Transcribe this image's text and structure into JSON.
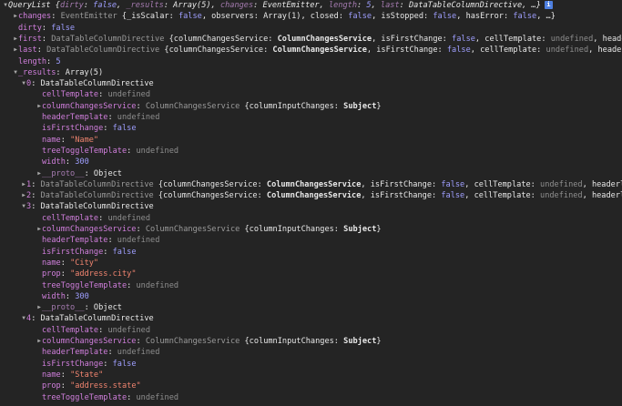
{
  "console": {
    "lines": [
      {
        "indent": 0,
        "toggle": "down",
        "segments": [
          {
            "text": "QueryList ",
            "cls": "t-cls t-it"
          },
          {
            "text": "{",
            "cls": "t-pun t-it"
          },
          {
            "text": "dirty",
            "cls": "t-keydim t-it"
          },
          {
            "text": ": ",
            "cls": "t-pun t-it"
          },
          {
            "text": "false",
            "cls": "t-bool t-it"
          },
          {
            "text": ", ",
            "cls": "t-pun t-it"
          },
          {
            "text": "_results",
            "cls": "t-keydim t-it"
          },
          {
            "text": ": ",
            "cls": "t-pun t-it"
          },
          {
            "text": "Array(5)",
            "cls": "t-cls t-it"
          },
          {
            "text": ", ",
            "cls": "t-pun t-it"
          },
          {
            "text": "changes",
            "cls": "t-keydim t-it"
          },
          {
            "text": ": ",
            "cls": "t-pun t-it"
          },
          {
            "text": "EventEmitter",
            "cls": "t-cls t-it"
          },
          {
            "text": ", ",
            "cls": "t-pun t-it"
          },
          {
            "text": "length",
            "cls": "t-keydim t-it"
          },
          {
            "text": ": ",
            "cls": "t-pun t-it"
          },
          {
            "text": "5",
            "cls": "t-num t-it"
          },
          {
            "text": ", ",
            "cls": "t-pun t-it"
          },
          {
            "text": "last",
            "cls": "t-keydim t-it"
          },
          {
            "text": ": ",
            "cls": "t-pun t-it"
          },
          {
            "text": "DataTableColumnDirective",
            "cls": "t-cls t-it"
          },
          {
            "text": ", …}",
            "cls": "t-pun t-it"
          }
        ],
        "info": "i"
      },
      {
        "indent": 1,
        "toggle": "right",
        "segments": [
          {
            "text": "changes",
            "cls": "t-key"
          },
          {
            "text": ": ",
            "cls": "t-pun"
          },
          {
            "text": "EventEmitter ",
            "cls": "t-clsdim"
          },
          {
            "text": "{_isScalar: ",
            "cls": "t-pun"
          },
          {
            "text": "false",
            "cls": "t-bool"
          },
          {
            "text": ", observers: Array(1), closed: ",
            "cls": "t-pun"
          },
          {
            "text": "false",
            "cls": "t-bool"
          },
          {
            "text": ", isStopped: ",
            "cls": "t-pun"
          },
          {
            "text": "false",
            "cls": "t-bool"
          },
          {
            "text": ", hasError: ",
            "cls": "t-pun"
          },
          {
            "text": "false",
            "cls": "t-bool"
          },
          {
            "text": ", …}",
            "cls": "t-pun"
          }
        ]
      },
      {
        "indent": 1,
        "toggle": "",
        "segments": [
          {
            "text": "dirty",
            "cls": "t-key"
          },
          {
            "text": ": ",
            "cls": "t-pun"
          },
          {
            "text": "false",
            "cls": "t-bool"
          }
        ]
      },
      {
        "indent": 1,
        "toggle": "right",
        "segments": [
          {
            "text": "first",
            "cls": "t-key"
          },
          {
            "text": ": ",
            "cls": "t-pun"
          },
          {
            "text": "DataTableColumnDirective ",
            "cls": "t-clsdim"
          },
          {
            "text": "{columnChangesService: ",
            "cls": "t-pun"
          },
          {
            "text": "ColumnChangesService",
            "cls": "t-cls t-bold"
          },
          {
            "text": ", isFirstChange: ",
            "cls": "t-pun"
          },
          {
            "text": "false",
            "cls": "t-bool"
          },
          {
            "text": ", cellTemplate: ",
            "cls": "t-pun"
          },
          {
            "text": "undefined",
            "cls": "t-null"
          },
          {
            "text": ", heade",
            "cls": "t-pun"
          }
        ]
      },
      {
        "indent": 1,
        "toggle": "right",
        "segments": [
          {
            "text": "last",
            "cls": "t-key"
          },
          {
            "text": ": ",
            "cls": "t-pun"
          },
          {
            "text": "DataTableColumnDirective ",
            "cls": "t-clsdim"
          },
          {
            "text": "{columnChangesService: ",
            "cls": "t-pun"
          },
          {
            "text": "ColumnChangesService",
            "cls": "t-cls t-bold"
          },
          {
            "text": ", isFirstChange: ",
            "cls": "t-pun"
          },
          {
            "text": "false",
            "cls": "t-bool"
          },
          {
            "text": ", cellTemplate: ",
            "cls": "t-pun"
          },
          {
            "text": "undefined",
            "cls": "t-null"
          },
          {
            "text": ", heade",
            "cls": "t-pun"
          }
        ]
      },
      {
        "indent": 1,
        "toggle": "",
        "segments": [
          {
            "text": "length",
            "cls": "t-key"
          },
          {
            "text": ": ",
            "cls": "t-pun"
          },
          {
            "text": "5",
            "cls": "t-num"
          }
        ]
      },
      {
        "indent": 1,
        "toggle": "down",
        "segments": [
          {
            "text": "_results",
            "cls": "t-key"
          },
          {
            "text": ": ",
            "cls": "t-pun"
          },
          {
            "text": "Array(5)",
            "cls": "t-cls"
          }
        ]
      },
      {
        "indent": 2,
        "toggle": "down",
        "segments": [
          {
            "text": "0",
            "cls": "t-key"
          },
          {
            "text": ": ",
            "cls": "t-pun"
          },
          {
            "text": "DataTableColumnDirective",
            "cls": "t-cls"
          }
        ]
      },
      {
        "indent": 3,
        "toggle": "",
        "segments": [
          {
            "text": "cellTemplate",
            "cls": "t-key"
          },
          {
            "text": ": ",
            "cls": "t-pun"
          },
          {
            "text": "undefined",
            "cls": "t-null"
          }
        ]
      },
      {
        "indent": 3,
        "toggle": "right",
        "segments": [
          {
            "text": "columnChangesService",
            "cls": "t-key"
          },
          {
            "text": ": ",
            "cls": "t-pun"
          },
          {
            "text": "ColumnChangesService ",
            "cls": "t-clsdim"
          },
          {
            "text": "{columnInputChanges: ",
            "cls": "t-pun"
          },
          {
            "text": "Subject",
            "cls": "t-cls t-bold"
          },
          {
            "text": "}",
            "cls": "t-pun"
          }
        ]
      },
      {
        "indent": 3,
        "toggle": "",
        "segments": [
          {
            "text": "headerTemplate",
            "cls": "t-key"
          },
          {
            "text": ": ",
            "cls": "t-pun"
          },
          {
            "text": "undefined",
            "cls": "t-null"
          }
        ]
      },
      {
        "indent": 3,
        "toggle": "",
        "segments": [
          {
            "text": "isFirstChange",
            "cls": "t-key"
          },
          {
            "text": ": ",
            "cls": "t-pun"
          },
          {
            "text": "false",
            "cls": "t-bool"
          }
        ]
      },
      {
        "indent": 3,
        "toggle": "",
        "segments": [
          {
            "text": "name",
            "cls": "t-key"
          },
          {
            "text": ": ",
            "cls": "t-pun"
          },
          {
            "text": "\"Name\"",
            "cls": "t-str"
          }
        ]
      },
      {
        "indent": 3,
        "toggle": "",
        "segments": [
          {
            "text": "treeToggleTemplate",
            "cls": "t-key"
          },
          {
            "text": ": ",
            "cls": "t-pun"
          },
          {
            "text": "undefined",
            "cls": "t-null"
          }
        ]
      },
      {
        "indent": 3,
        "toggle": "",
        "segments": [
          {
            "text": "width",
            "cls": "t-key"
          },
          {
            "text": ": ",
            "cls": "t-pun"
          },
          {
            "text": "300",
            "cls": "t-num"
          }
        ]
      },
      {
        "indent": 3,
        "toggle": "right",
        "segments": [
          {
            "text": "__proto__",
            "cls": "t-keydim"
          },
          {
            "text": ": Object",
            "cls": "t-pun"
          }
        ]
      },
      {
        "indent": 2,
        "toggle": "right",
        "segments": [
          {
            "text": "1",
            "cls": "t-key"
          },
          {
            "text": ": ",
            "cls": "t-pun"
          },
          {
            "text": "DataTableColumnDirective ",
            "cls": "t-clsdim"
          },
          {
            "text": "{columnChangesService: ",
            "cls": "t-pun"
          },
          {
            "text": "ColumnChangesService",
            "cls": "t-cls t-bold"
          },
          {
            "text": ", isFirstChange: ",
            "cls": "t-pun"
          },
          {
            "text": "false",
            "cls": "t-bool"
          },
          {
            "text": ", cellTemplate: ",
            "cls": "t-pun"
          },
          {
            "text": "undefined",
            "cls": "t-null"
          },
          {
            "text": ", headerl",
            "cls": "t-pun"
          }
        ]
      },
      {
        "indent": 2,
        "toggle": "right",
        "segments": [
          {
            "text": "2",
            "cls": "t-key"
          },
          {
            "text": ": ",
            "cls": "t-pun"
          },
          {
            "text": "DataTableColumnDirective ",
            "cls": "t-clsdim"
          },
          {
            "text": "{columnChangesService: ",
            "cls": "t-pun"
          },
          {
            "text": "ColumnChangesService",
            "cls": "t-cls t-bold"
          },
          {
            "text": ", isFirstChange: ",
            "cls": "t-pun"
          },
          {
            "text": "false",
            "cls": "t-bool"
          },
          {
            "text": ", cellTemplate: ",
            "cls": "t-pun"
          },
          {
            "text": "undefined",
            "cls": "t-null"
          },
          {
            "text": ", headerl",
            "cls": "t-pun"
          }
        ]
      },
      {
        "indent": 2,
        "toggle": "down",
        "segments": [
          {
            "text": "3",
            "cls": "t-key"
          },
          {
            "text": ": ",
            "cls": "t-pun"
          },
          {
            "text": "DataTableColumnDirective",
            "cls": "t-cls"
          }
        ]
      },
      {
        "indent": 3,
        "toggle": "",
        "segments": [
          {
            "text": "cellTemplate",
            "cls": "t-key"
          },
          {
            "text": ": ",
            "cls": "t-pun"
          },
          {
            "text": "undefined",
            "cls": "t-null"
          }
        ]
      },
      {
        "indent": 3,
        "toggle": "right",
        "segments": [
          {
            "text": "columnChangesService",
            "cls": "t-key"
          },
          {
            "text": ": ",
            "cls": "t-pun"
          },
          {
            "text": "ColumnChangesService ",
            "cls": "t-clsdim"
          },
          {
            "text": "{columnInputChanges: ",
            "cls": "t-pun"
          },
          {
            "text": "Subject",
            "cls": "t-cls t-bold"
          },
          {
            "text": "}",
            "cls": "t-pun"
          }
        ]
      },
      {
        "indent": 3,
        "toggle": "",
        "segments": [
          {
            "text": "headerTemplate",
            "cls": "t-key"
          },
          {
            "text": ": ",
            "cls": "t-pun"
          },
          {
            "text": "undefined",
            "cls": "t-null"
          }
        ]
      },
      {
        "indent": 3,
        "toggle": "",
        "segments": [
          {
            "text": "isFirstChange",
            "cls": "t-key"
          },
          {
            "text": ": ",
            "cls": "t-pun"
          },
          {
            "text": "false",
            "cls": "t-bool"
          }
        ]
      },
      {
        "indent": 3,
        "toggle": "",
        "segments": [
          {
            "text": "name",
            "cls": "t-key"
          },
          {
            "text": ": ",
            "cls": "t-pun"
          },
          {
            "text": "\"City\"",
            "cls": "t-str"
          }
        ]
      },
      {
        "indent": 3,
        "toggle": "",
        "segments": [
          {
            "text": "prop",
            "cls": "t-key"
          },
          {
            "text": ": ",
            "cls": "t-pun"
          },
          {
            "text": "\"address.city\"",
            "cls": "t-str"
          }
        ]
      },
      {
        "indent": 3,
        "toggle": "",
        "segments": [
          {
            "text": "treeToggleTemplate",
            "cls": "t-key"
          },
          {
            "text": ": ",
            "cls": "t-pun"
          },
          {
            "text": "undefined",
            "cls": "t-null"
          }
        ]
      },
      {
        "indent": 3,
        "toggle": "",
        "segments": [
          {
            "text": "width",
            "cls": "t-key"
          },
          {
            "text": ": ",
            "cls": "t-pun"
          },
          {
            "text": "300",
            "cls": "t-num"
          }
        ]
      },
      {
        "indent": 3,
        "toggle": "right",
        "segments": [
          {
            "text": "__proto__",
            "cls": "t-keydim"
          },
          {
            "text": ": Object",
            "cls": "t-pun"
          }
        ]
      },
      {
        "indent": 2,
        "toggle": "down",
        "segments": [
          {
            "text": "4",
            "cls": "t-key"
          },
          {
            "text": ": ",
            "cls": "t-pun"
          },
          {
            "text": "DataTableColumnDirective",
            "cls": "t-cls"
          }
        ]
      },
      {
        "indent": 3,
        "toggle": "",
        "segments": [
          {
            "text": "cellTemplate",
            "cls": "t-key"
          },
          {
            "text": ": ",
            "cls": "t-pun"
          },
          {
            "text": "undefined",
            "cls": "t-null"
          }
        ]
      },
      {
        "indent": 3,
        "toggle": "right",
        "segments": [
          {
            "text": "columnChangesService",
            "cls": "t-key"
          },
          {
            "text": ": ",
            "cls": "t-pun"
          },
          {
            "text": "ColumnChangesService ",
            "cls": "t-clsdim"
          },
          {
            "text": "{columnInputChanges: ",
            "cls": "t-pun"
          },
          {
            "text": "Subject",
            "cls": "t-cls t-bold"
          },
          {
            "text": "}",
            "cls": "t-pun"
          }
        ]
      },
      {
        "indent": 3,
        "toggle": "",
        "segments": [
          {
            "text": "headerTemplate",
            "cls": "t-key"
          },
          {
            "text": ": ",
            "cls": "t-pun"
          },
          {
            "text": "undefined",
            "cls": "t-null"
          }
        ]
      },
      {
        "indent": 3,
        "toggle": "",
        "segments": [
          {
            "text": "isFirstChange",
            "cls": "t-key"
          },
          {
            "text": ": ",
            "cls": "t-pun"
          },
          {
            "text": "false",
            "cls": "t-bool"
          }
        ]
      },
      {
        "indent": 3,
        "toggle": "",
        "segments": [
          {
            "text": "name",
            "cls": "t-key"
          },
          {
            "text": ": ",
            "cls": "t-pun"
          },
          {
            "text": "\"State\"",
            "cls": "t-str"
          }
        ]
      },
      {
        "indent": 3,
        "toggle": "",
        "segments": [
          {
            "text": "prop",
            "cls": "t-key"
          },
          {
            "text": ": ",
            "cls": "t-pun"
          },
          {
            "text": "\"address.state\"",
            "cls": "t-str"
          }
        ]
      },
      {
        "indent": 3,
        "toggle": "",
        "segments": [
          {
            "text": "treeToggleTemplate",
            "cls": "t-key"
          },
          {
            "text": ": ",
            "cls": "t-pun"
          },
          {
            "text": "undefined",
            "cls": "t-null"
          }
        ]
      }
    ]
  }
}
